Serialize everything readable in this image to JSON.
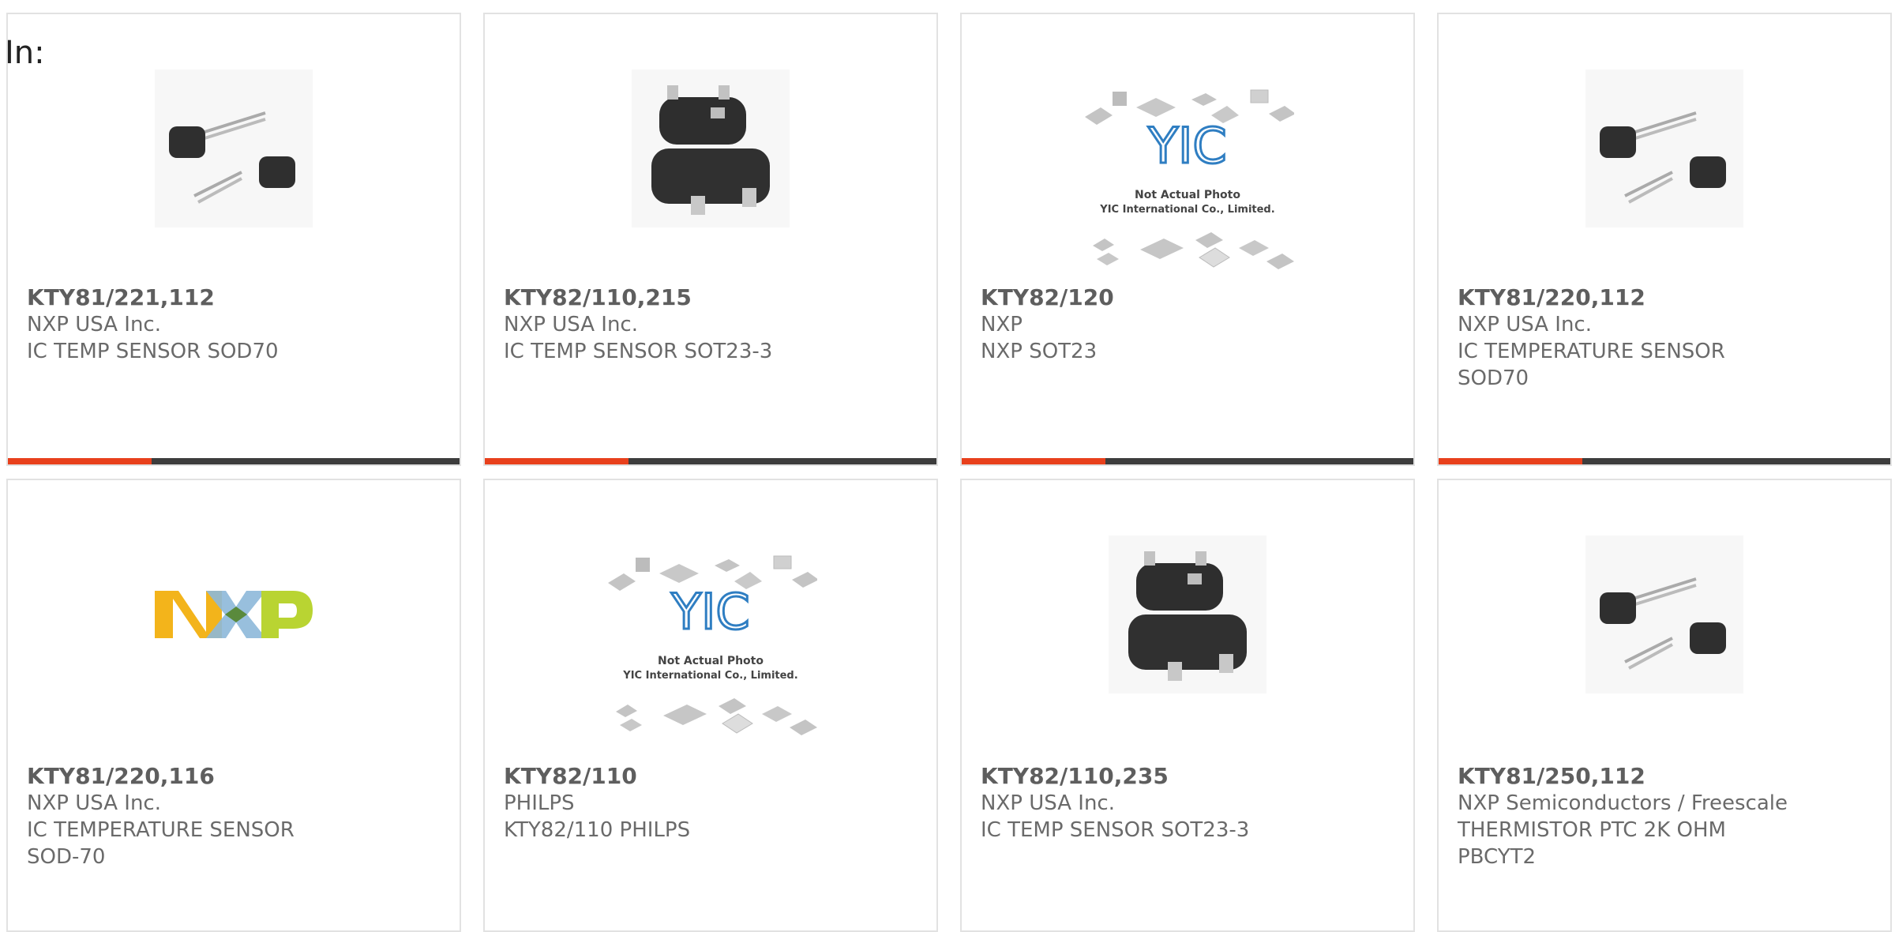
{
  "header": {
    "in_label": "In:"
  },
  "image_captions": {
    "yic_logo": "YIC",
    "yic_line1": "Not Actual Photo",
    "yic_line2": "YIC International Co., Limited."
  },
  "products": [
    {
      "part": "KTY81/221,112",
      "maker": "NXP USA Inc.",
      "desc": "IC TEMP SENSOR SOD70",
      "image": "to92-sensor-image"
    },
    {
      "part": "KTY82/110,215",
      "maker": "NXP USA Inc.",
      "desc": "IC TEMP SENSOR SOT23-3",
      "image": "sot23-package-image"
    },
    {
      "part": "KTY82/120",
      "maker": "NXP",
      "desc": "NXP SOT23",
      "image": "not-actual-photo-placeholder"
    },
    {
      "part": "KTY81/220,112",
      "maker": "NXP USA Inc.",
      "desc": "IC TEMPERATURE SENSOR SOD70",
      "image": "to92-sensor-image"
    },
    {
      "part": "KTY81/220,116",
      "maker": "NXP USA Inc.",
      "desc": "IC TEMPERATURE SENSOR SOD-70",
      "image": "nxp-logo"
    },
    {
      "part": "KTY82/110",
      "maker": "PHILPS",
      "desc": "KTY82/110 PHILPS",
      "image": "not-actual-photo-placeholder"
    },
    {
      "part": "KTY82/110,235",
      "maker": "NXP USA Inc.",
      "desc": "IC TEMP SENSOR SOT23-3",
      "image": "sot23-package-image"
    },
    {
      "part": "KTY81/250,112",
      "maker": "NXP Semiconductors / Freescale",
      "desc": "THERMISTOR PTC 2K OHM PBCYT2",
      "image": "to92-sensor-image"
    }
  ],
  "colors": {
    "accent": "#e8401c",
    "bar": "#3d3d3d",
    "border": "#e2e2e2",
    "text": "#666666"
  }
}
